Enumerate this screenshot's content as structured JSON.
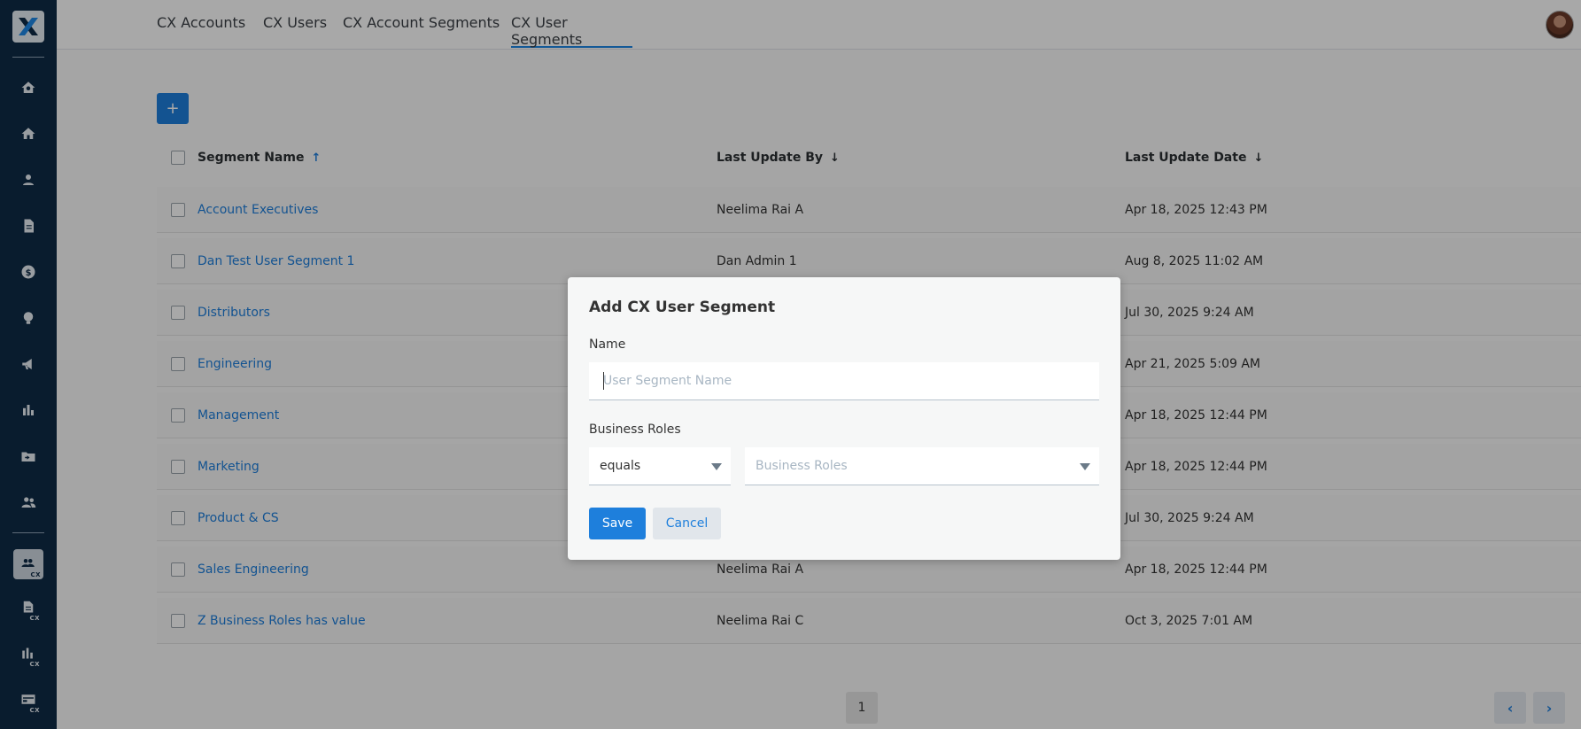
{
  "colors": {
    "sidebar": "#0f2b46",
    "accent": "#1e7fdc",
    "tab_underline": "#1e88e5"
  },
  "sidebar": {
    "icons": [
      "home-gear-icon",
      "home-icon",
      "person-icon",
      "document-icon",
      "dollar-icon",
      "lightbulb-icon",
      "megaphone-icon",
      "bar-chart-icon",
      "folder-move-icon",
      "people-icon",
      "cx-people-icon",
      "cx-document-icon",
      "cx-bar-chart-icon",
      "cx-card-icon"
    ],
    "cx_sub_label": "CX"
  },
  "tabs": [
    {
      "label": "CX Accounts"
    },
    {
      "label": "CX Users"
    },
    {
      "label": "CX Account Segments"
    },
    {
      "label": "CX User Segments",
      "active": true
    }
  ],
  "toolbar": {
    "add_label": "+"
  },
  "table": {
    "columns": [
      {
        "label": "Segment Name",
        "sort": "↑"
      },
      {
        "label": "Last Update By",
        "sort": "↓"
      },
      {
        "label": "Last Update Date",
        "sort": "↓"
      }
    ],
    "rows": [
      {
        "name": "Account Executives",
        "by": "Neelima Rai A",
        "date": "Apr 18, 2025 12:43 PM"
      },
      {
        "name": "Dan Test User Segment 1",
        "by": "Dan Admin 1",
        "date": "Aug 8, 2025 11:02 AM"
      },
      {
        "name": "Distributors",
        "by": "",
        "date": "Jul 30, 2025 9:24 AM"
      },
      {
        "name": "Engineering",
        "by": "",
        "date": "Apr 21, 2025 5:09 AM"
      },
      {
        "name": "Management",
        "by": "",
        "date": "Apr 18, 2025 12:44 PM"
      },
      {
        "name": "Marketing",
        "by": "",
        "date": "Apr 18, 2025 12:44 PM"
      },
      {
        "name": "Product & CS",
        "by": "",
        "date": "Jul 30, 2025 9:24 AM"
      },
      {
        "name": "Sales Engineering",
        "by": "Neelima Rai A",
        "date": "Apr 18, 2025 12:44 PM"
      },
      {
        "name": "Z Business Roles has value",
        "by": "Neelima Rai C",
        "date": "Oct 3, 2025 7:01 AM"
      }
    ]
  },
  "pagination": {
    "page": "1",
    "prev": "‹",
    "next": "›"
  },
  "modal": {
    "title": "Add CX User Segment",
    "name_label": "Name",
    "name_placeholder": "User Segment Name",
    "roles_label": "Business Roles",
    "operator_value": "equals",
    "roles_placeholder": "Business Roles",
    "save_label": "Save",
    "cancel_label": "Cancel"
  }
}
